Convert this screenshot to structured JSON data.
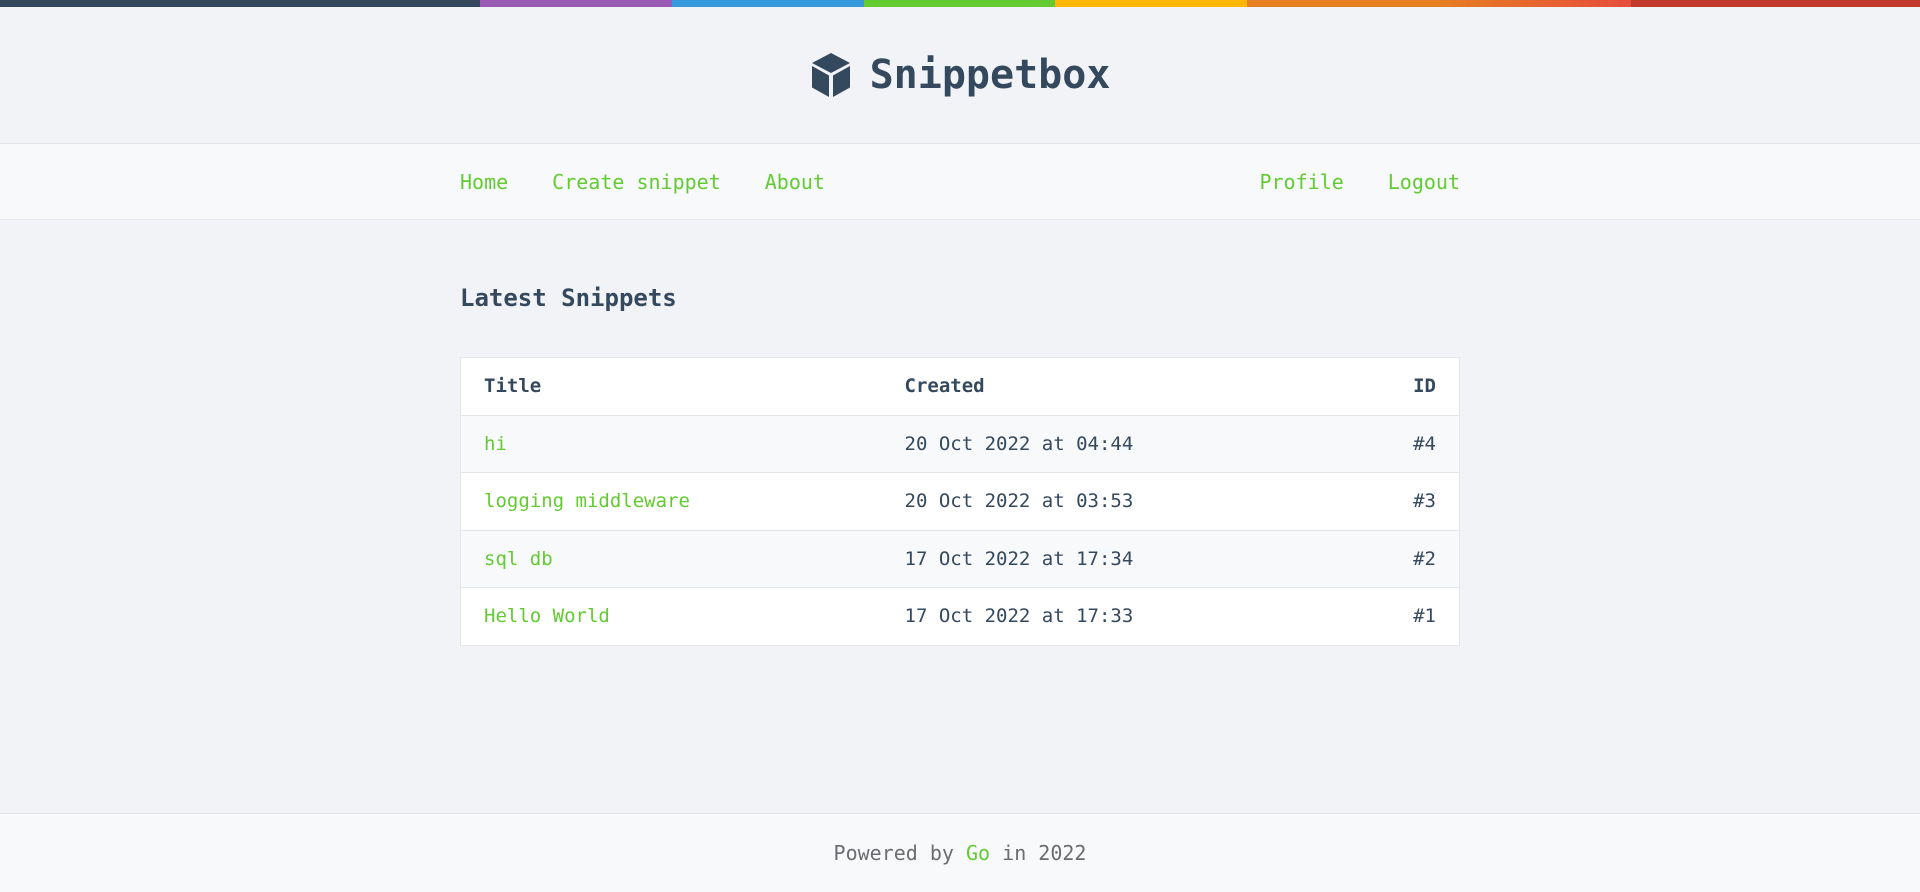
{
  "colors": {
    "accent": "#62cb31",
    "text": "#34495e",
    "topbar": [
      "#34495e",
      "#9b59b6",
      "#3498db",
      "#62cb31",
      "#ffb606",
      "#e67e22",
      "#e74c3c",
      "#c0392b"
    ]
  },
  "header": {
    "logo_icon": "cube-icon",
    "title": "Snippetbox"
  },
  "nav": {
    "left": [
      {
        "label": "Home"
      },
      {
        "label": "Create snippet"
      },
      {
        "label": "About"
      }
    ],
    "right": [
      {
        "label": "Profile"
      },
      {
        "label": "Logout"
      }
    ]
  },
  "main": {
    "title": "Latest Snippets",
    "table": {
      "columns": [
        "Title",
        "Created",
        "ID"
      ],
      "rows": [
        {
          "title": "hi",
          "created": "20 Oct 2022 at 04:44",
          "id": "#4"
        },
        {
          "title": "logging middleware",
          "created": "20 Oct 2022 at 03:53",
          "id": "#3"
        },
        {
          "title": "sql db",
          "created": "17 Oct 2022 at 17:34",
          "id": "#2"
        },
        {
          "title": "Hello World",
          "created": "17 Oct 2022 at 17:33",
          "id": "#1"
        }
      ]
    }
  },
  "footer": {
    "prefix": "Powered by",
    "link": "Go",
    "suffix": "in 2022"
  }
}
